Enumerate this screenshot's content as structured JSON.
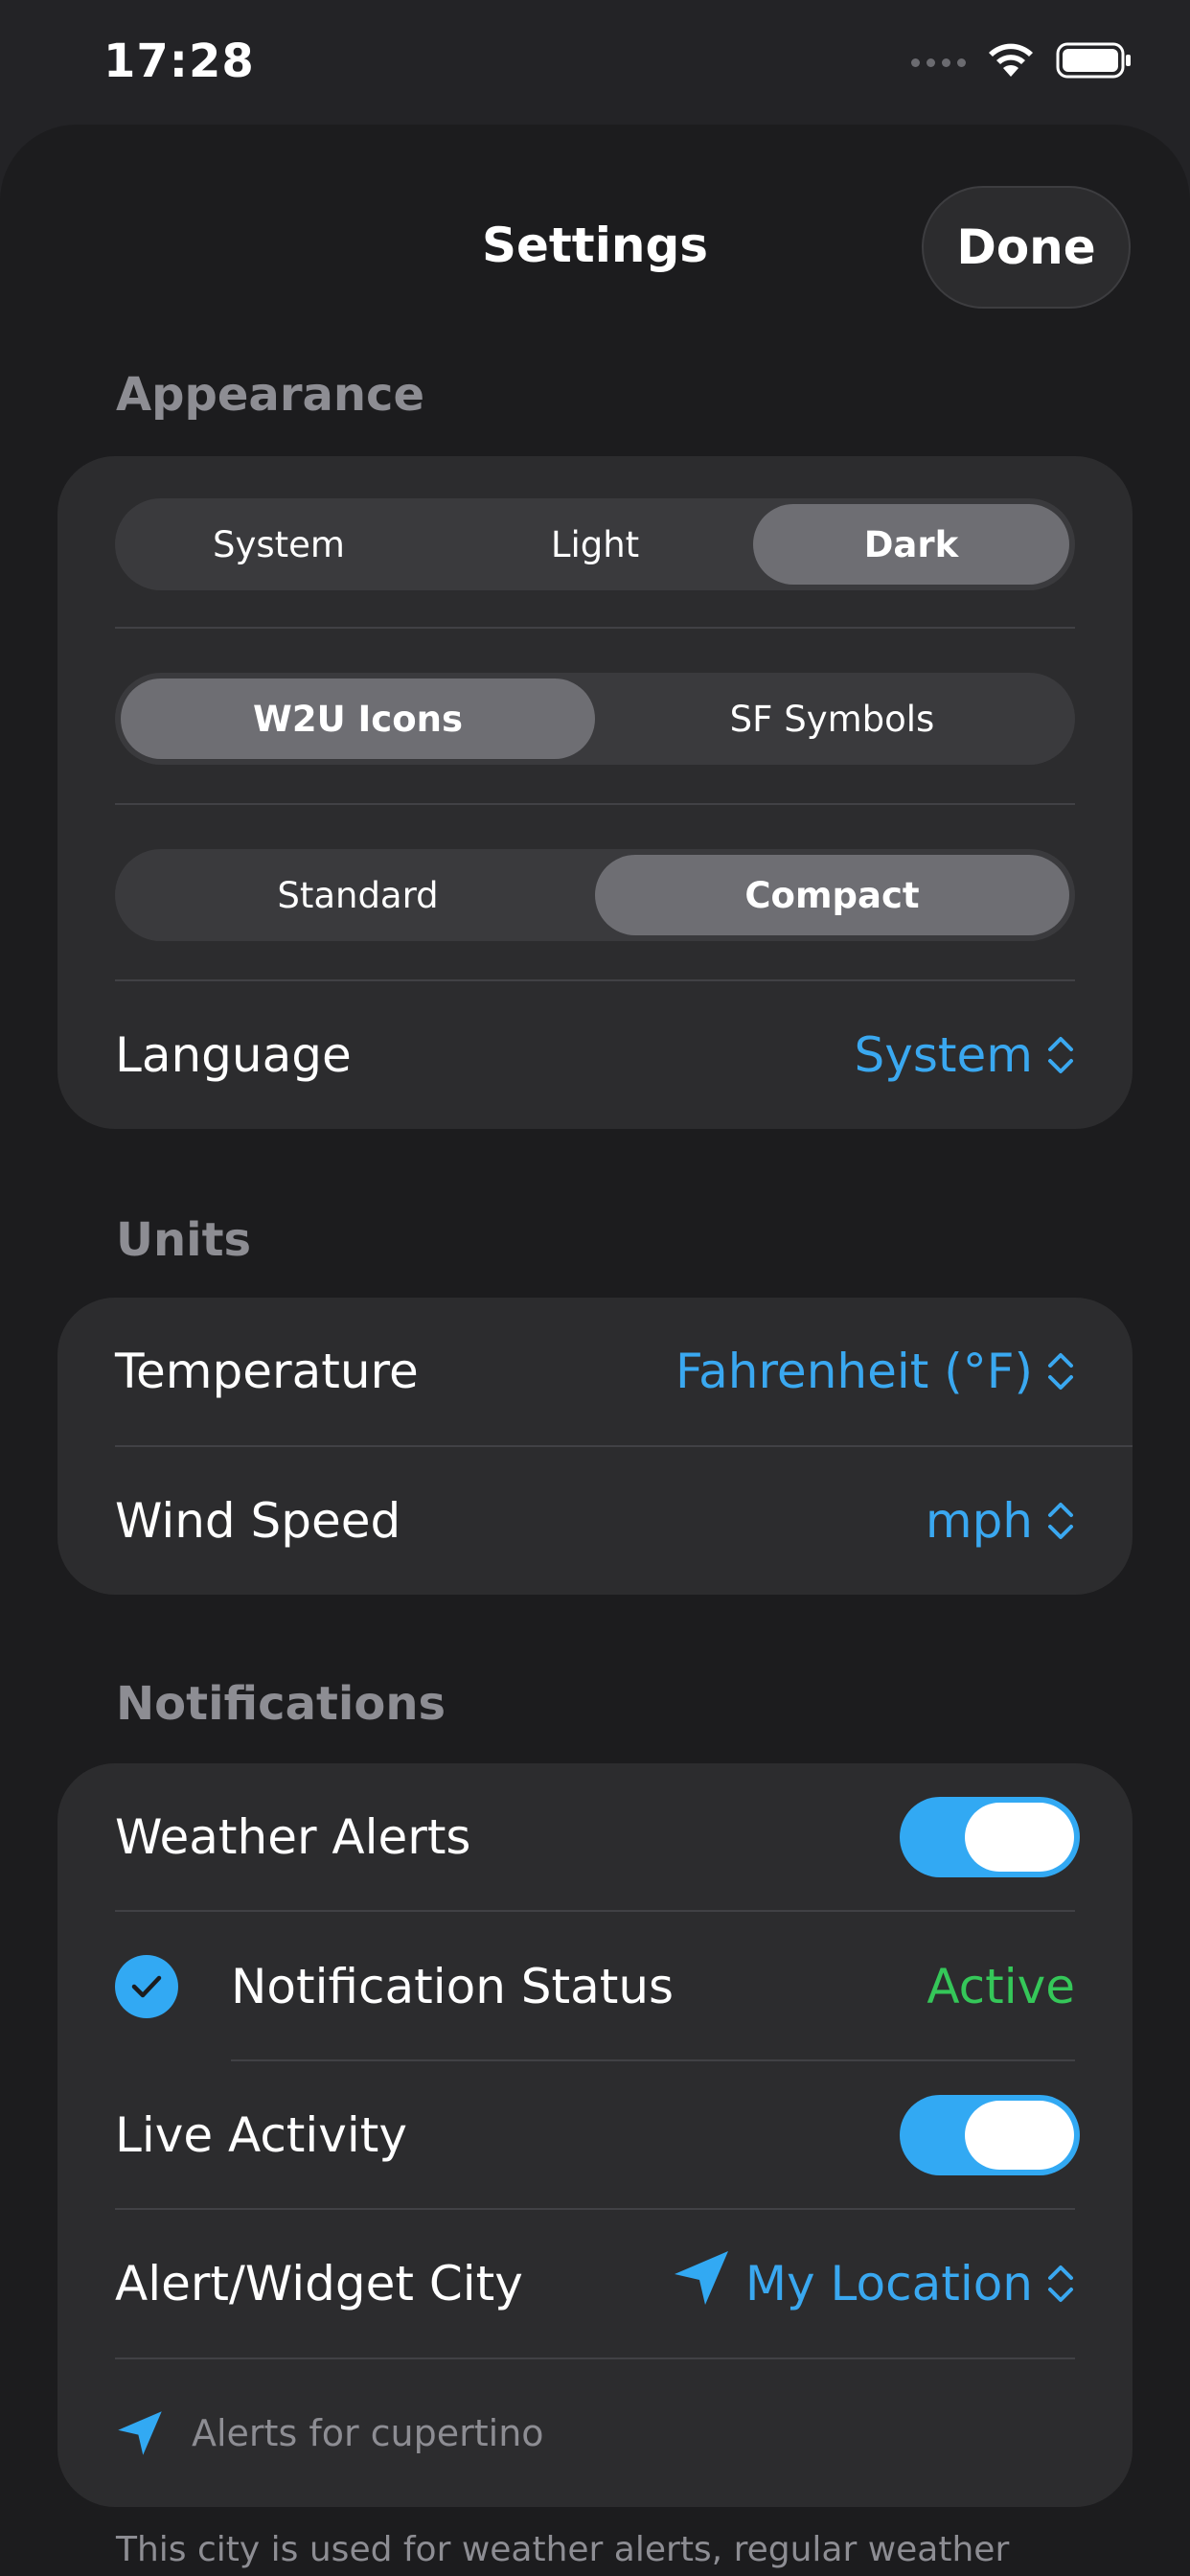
{
  "status_bar": {
    "time": "17:28"
  },
  "header": {
    "title": "Settings",
    "done_label": "Done"
  },
  "appearance": {
    "section_title": "Appearance",
    "theme": {
      "options": [
        "System",
        "Light",
        "Dark"
      ],
      "selected": "Dark"
    },
    "icons": {
      "options": [
        "W2U Icons",
        "SF Symbols"
      ],
      "selected": "W2U Icons"
    },
    "density": {
      "options": [
        "Standard",
        "Compact"
      ],
      "selected": "Compact"
    },
    "language": {
      "label": "Language",
      "value": "System"
    }
  },
  "units": {
    "section_title": "Units",
    "temperature": {
      "label": "Temperature",
      "value": "Fahrenheit (°F)"
    },
    "wind_speed": {
      "label": "Wind Speed",
      "value": "mph"
    }
  },
  "notifications": {
    "section_title": "Notifications",
    "weather_alerts": {
      "label": "Weather Alerts",
      "enabled": true
    },
    "notification_status": {
      "label": "Notification Status",
      "value": "Active"
    },
    "live_activity": {
      "label": "Live Activity",
      "enabled": true
    },
    "alert_city": {
      "label": "Alert/Widget City",
      "value": "My Location"
    },
    "alerts_for": "Alerts for cupertino"
  },
  "footer_note": "This city is used for weather alerts, regular weather",
  "colors": {
    "accent": "#32a9f3",
    "active_green": "#35c759",
    "background": "#1c1c1e",
    "card": "#2c2c2e"
  }
}
